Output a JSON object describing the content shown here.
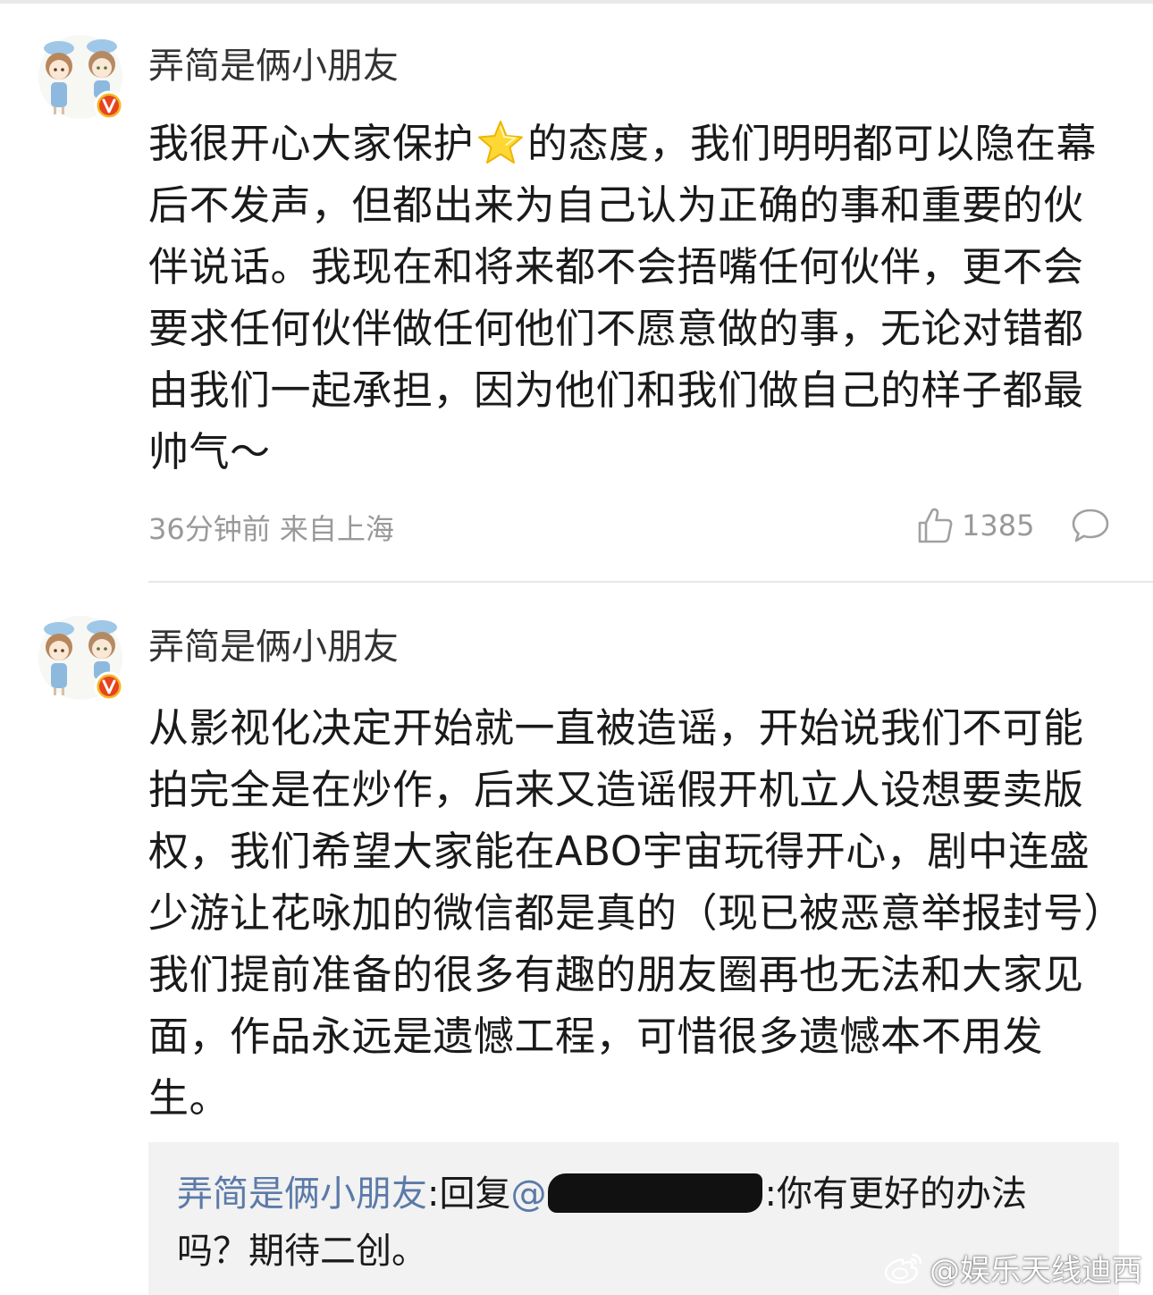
{
  "comments": [
    {
      "username": "弄简是俩小朋友",
      "content_before_star": "我很开心大家保护",
      "star_icon": "star-emoji",
      "content_after_star": "的态度，我们明明都可以隐在幕后不发声，但都出来为自己认为正确的事和重要的伙伴说话。我现在和将来都不会捂嘴任何伙伴，更不会要求任何伙伴做任何他们不愿意做的事，无论对错都由我们一起承担，因为他们和我们做自己的样子都最帅气～",
      "time_location": "36分钟前 来自上海",
      "likes": "1385",
      "like_icon": "thumbs-up-icon",
      "comment_icon": "comment-bubble-icon"
    },
    {
      "username": "弄简是俩小朋友",
      "content": "从影视化决定开始就一直被造谣，开始说我们不可能拍完全是在炒作，后来又造谣假开机立人设想要卖版权，我们希望大家能在ABO宇宙玩得开心，剧中连盛少游让花咏加的微信都是真的（现已被恶意举报封号）我们提前准备的很多有趣的朋友圈再也无法和大家见面，作品永远是遗憾工程，可惜很多遗憾本不用发生。",
      "reply": {
        "name": "弄简是俩小朋友",
        "sep": ":回复",
        "at": "@",
        "after": ":你有更好的办法吗？期待二创。"
      }
    }
  ],
  "watermark": {
    "icon": "weibo-logo-icon",
    "text": "@娱乐天线迪西"
  },
  "colors": {
    "username_link": "#5b7aa8",
    "meta_gray": "#999999",
    "verified_badge": "#f5a623",
    "reply_bg": "#f2f2f2"
  }
}
